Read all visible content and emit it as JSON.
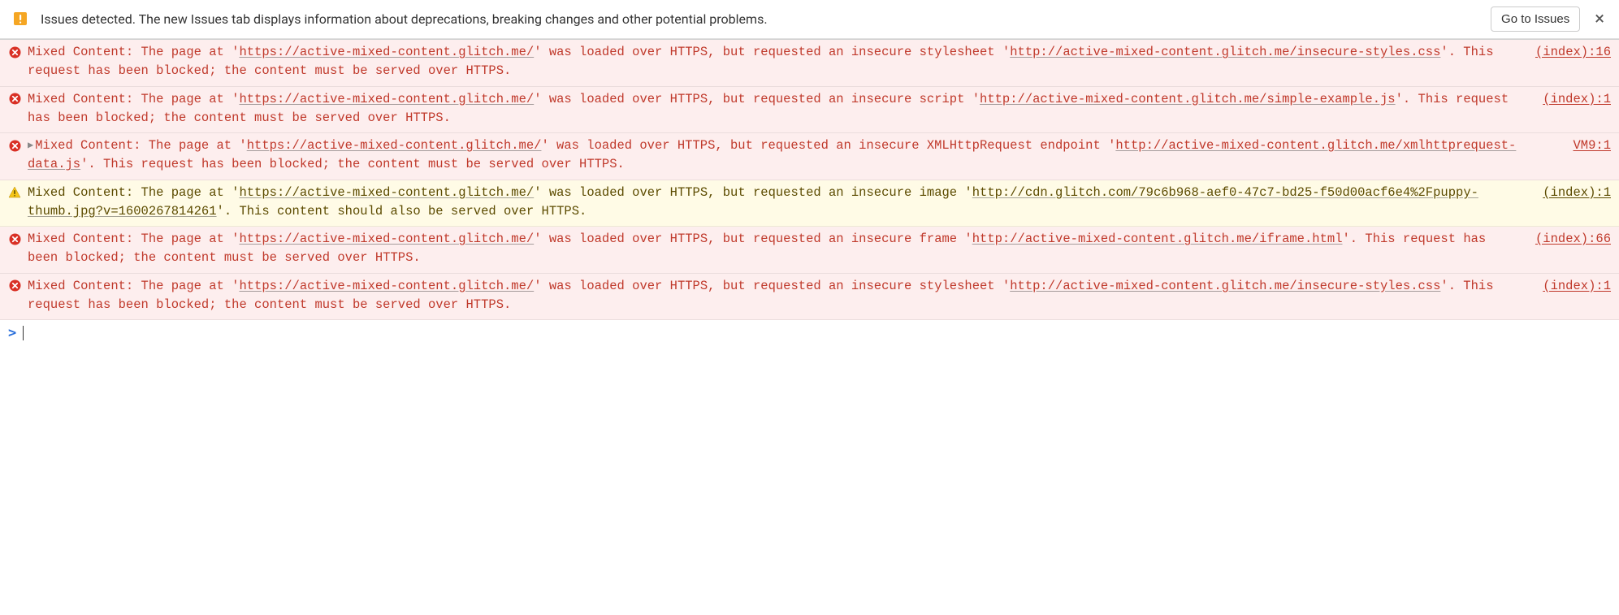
{
  "issues_bar": {
    "text": "Issues detected. The new Issues tab displays information about deprecations, breaking changes and other potential problems.",
    "button": "Go to Issues",
    "close": "×"
  },
  "logs": [
    {
      "level": "error",
      "expandable": false,
      "prefix": "Mixed Content: The page at '",
      "page_url": "https://active-mixed-content.glitch.me/",
      "mid1": "' was loaded over HTTPS, but requested an insecure stylesheet '",
      "res_url": "http://active-mixed-content.glitch.me/insecure-styles.css",
      "suffix": "'. This request has been blocked; the content must be served over HTTPS.",
      "source": "(index):16"
    },
    {
      "level": "error",
      "expandable": false,
      "prefix": "Mixed Content: The page at '",
      "page_url": "https://active-mixed-content.glitch.me/",
      "mid1": "' was loaded over HTTPS, but requested an insecure script '",
      "res_url": "http://active-mixed-content.glitch.me/simple-example.js",
      "suffix": "'. This request has been blocked; the content must be served over HTTPS.",
      "source": "(index):1"
    },
    {
      "level": "error",
      "expandable": true,
      "prefix": "Mixed Content: The page at '",
      "page_url": "https://active-mixed-content.glitch.me/",
      "mid1": "' was loaded over HTTPS, but requested an insecure XMLHttpRequest endpoint '",
      "res_url": "http://active-mixed-content.glitch.me/xmlhttprequest-data.js",
      "suffix": "'. This request has been blocked; the content must be served over HTTPS.",
      "source": "VM9:1"
    },
    {
      "level": "warning",
      "expandable": false,
      "prefix": "Mixed Content: The page at '",
      "page_url": "https://active-mixed-content.glitch.me/",
      "mid1": "' was loaded over HTTPS, but requested an insecure image '",
      "res_url": "http://cdn.glitch.com/79c6b968-aef0-47c7-bd25-f50d00acf6e4%2Fpuppy-thumb.jpg?v=1600267814261",
      "suffix": "'. This content should also be served over HTTPS.",
      "source": "(index):1"
    },
    {
      "level": "error",
      "expandable": false,
      "prefix": "Mixed Content: The page at '",
      "page_url": "https://active-mixed-content.glitch.me/",
      "mid1": "' was loaded over HTTPS, but requested an insecure frame '",
      "res_url": "http://active-mixed-content.glitch.me/iframe.html",
      "suffix": "'. This request has been blocked; the content must be served over HTTPS.",
      "source": "(index):66"
    },
    {
      "level": "error",
      "expandable": false,
      "prefix": "Mixed Content: The page at '",
      "page_url": "https://active-mixed-content.glitch.me/",
      "mid1": "' was loaded over HTTPS, but requested an insecure stylesheet '",
      "res_url": "http://active-mixed-content.glitch.me/insecure-styles.css",
      "suffix": "'. This request has been blocked; the content must be served over HTTPS.",
      "source": "(index):1"
    }
  ],
  "prompt": ">"
}
